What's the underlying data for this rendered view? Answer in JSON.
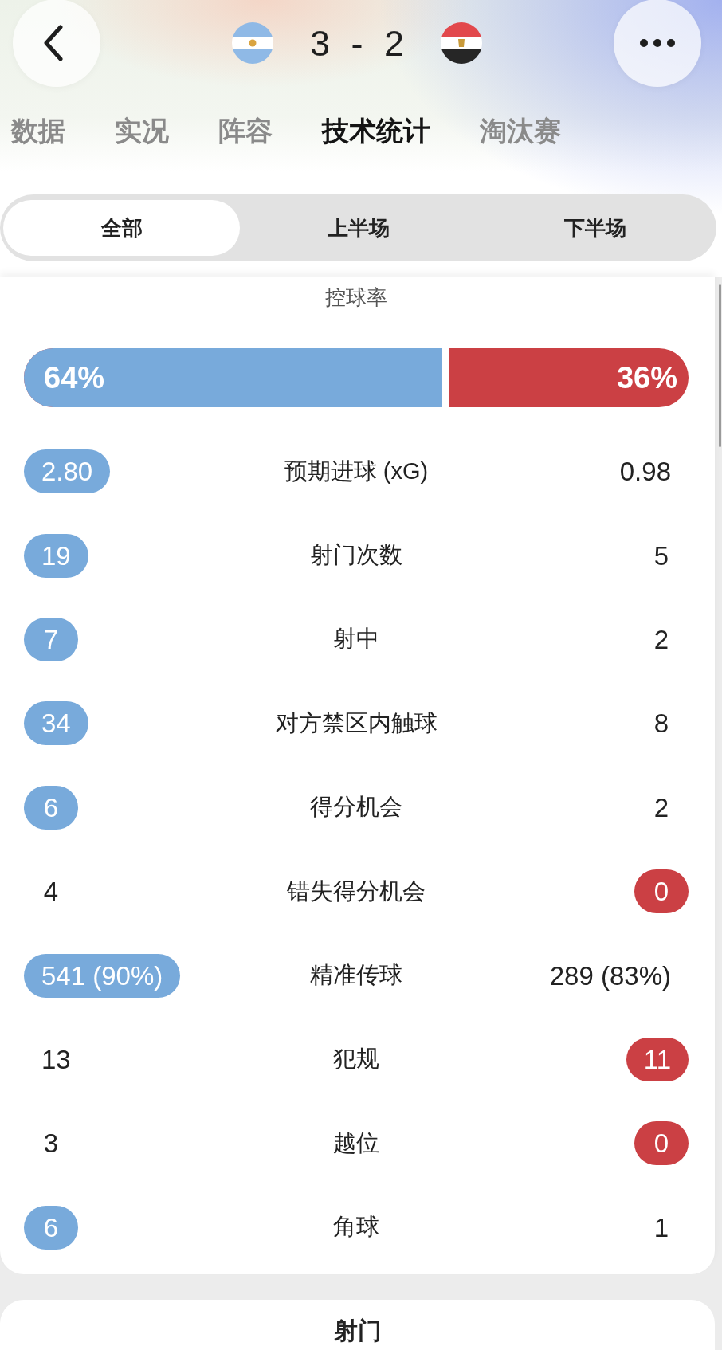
{
  "header": {
    "score": "3 - 2"
  },
  "tabs": [
    {
      "label": "数据",
      "selected": false
    },
    {
      "label": "实况",
      "selected": false
    },
    {
      "label": "阵容",
      "selected": false
    },
    {
      "label": "技术统计",
      "selected": true
    },
    {
      "label": "淘汰赛",
      "selected": false
    }
  ],
  "periods": [
    {
      "label": "全部",
      "selected": true
    },
    {
      "label": "上半场",
      "selected": false
    },
    {
      "label": "下半场",
      "selected": false
    }
  ],
  "possession": {
    "title": "控球率",
    "home": "64%",
    "away": "36%",
    "level": 0.64
  },
  "stats": [
    {
      "label": "预期进球 (xG)",
      "home": {
        "value": "2.80",
        "highlighted": true
      },
      "away": {
        "value": "0.98",
        "highlighted": false
      }
    },
    {
      "label": "射门次数",
      "home": {
        "value": "19",
        "highlighted": true
      },
      "away": {
        "value": "5",
        "highlighted": false
      }
    },
    {
      "label": "射中",
      "home": {
        "value": "7",
        "highlighted": true
      },
      "away": {
        "value": "2",
        "highlighted": false
      }
    },
    {
      "label": "对方禁区内触球",
      "home": {
        "value": "34",
        "highlighted": true
      },
      "away": {
        "value": "8",
        "highlighted": false
      }
    },
    {
      "label": "得分机会",
      "home": {
        "value": "6",
        "highlighted": true
      },
      "away": {
        "value": "2",
        "highlighted": false
      }
    },
    {
      "label": "错失得分机会",
      "home": {
        "value": "4",
        "highlighted": false
      },
      "away": {
        "value": "0",
        "highlighted": true
      }
    },
    {
      "label": "精准传球",
      "home": {
        "value": "541 (90%)",
        "highlighted": true
      },
      "away": {
        "value": "289 (83%)",
        "highlighted": false
      }
    },
    {
      "label": "犯规",
      "home": {
        "value": "13",
        "highlighted": false
      },
      "away": {
        "value": "11",
        "highlighted": true
      }
    },
    {
      "label": "越位",
      "home": {
        "value": "3",
        "highlighted": false
      },
      "away": {
        "value": "0",
        "highlighted": true
      }
    },
    {
      "label": "角球",
      "home": {
        "value": "6",
        "highlighted": true
      },
      "away": {
        "value": "1",
        "highlighted": false
      }
    }
  ],
  "next_section": {
    "title": "射门"
  }
}
